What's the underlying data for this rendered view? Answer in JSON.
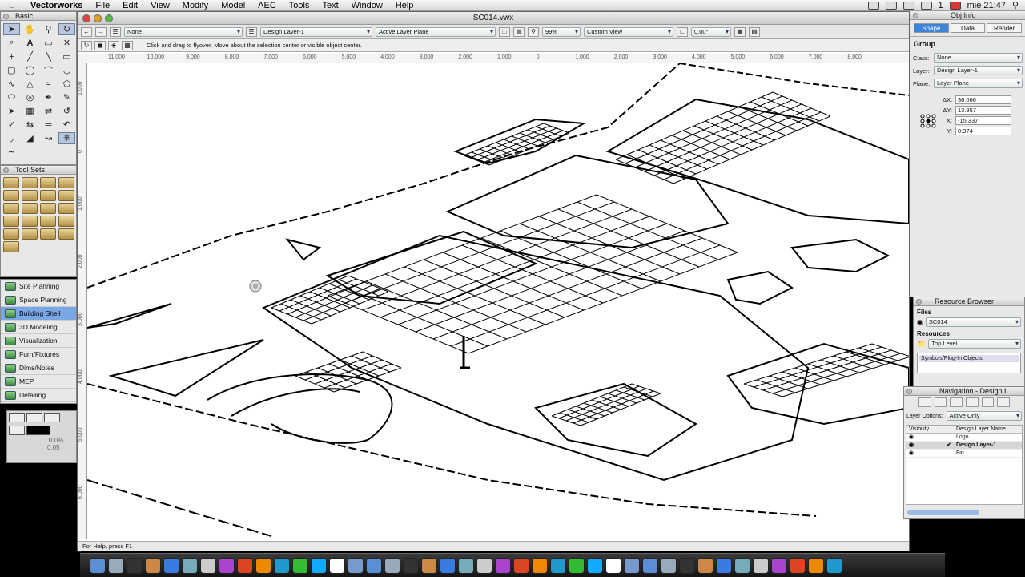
{
  "menubar": {
    "app": "Vectorworks",
    "items": [
      "File",
      "Edit",
      "View",
      "Modify",
      "Model",
      "AEC",
      "Tools",
      "Text",
      "Window",
      "Help"
    ],
    "clock": "mié 21:47",
    "count": "1"
  },
  "basic_palette": {
    "title": "Basic",
    "tools": [
      "selection-icon",
      "pan-icon",
      "zoom-icon",
      "flyover-icon",
      "text-icon",
      "line-icon",
      "rectangle-icon",
      "circle-icon",
      "arc-icon",
      "polygon-icon",
      "polyline-icon",
      "freehand-icon",
      "eyedropper-icon",
      "attribute-icon",
      "wall-icon",
      "round-wall-icon"
    ]
  },
  "toolsets": {
    "title": "Tool Sets",
    "items": [
      "Site Planning",
      "Space Planning",
      "Building Shell",
      "3D Modeling",
      "Visualization",
      "Furn/Fixtures",
      "Dims/Notes",
      "MEP",
      "Detailing"
    ],
    "active": "Building Shell"
  },
  "attributes": {
    "opacity": "100%",
    "lineweight": "0.05"
  },
  "document": {
    "title": "SC014.vwx",
    "class_select": "None",
    "layer_select": "Design Layer-1",
    "plane_select": "Active Layer Plane",
    "zoom": "99%",
    "view_select": "Custom View",
    "angle": "0.00°",
    "hint": "Click and drag to flyover. Move about the selection center or visible object center.",
    "status": "For Help, press F1",
    "ruler_h": [
      "11.000",
      "10.000",
      "9.000",
      "8.000",
      "7.000",
      "6.000",
      "5.000",
      "4.000",
      "3.000",
      "2.000",
      "1.000",
      "0",
      "1.000",
      "2.000",
      "3.000",
      "4.000",
      "5.000",
      "6.000",
      "7.000",
      "8.000"
    ],
    "ruler_v": [
      "1.000",
      "0",
      "1.000",
      "2.000",
      "3.000",
      "4.000",
      "5.000",
      "6.000",
      "7.000"
    ]
  },
  "obj_info": {
    "title": "Obj Info",
    "tabs": [
      "Shape",
      "Data",
      "Render"
    ],
    "type": "Group",
    "class_label": "Class:",
    "class_value": "None",
    "layer_label": "Layer:",
    "layer_value": "Design Layer-1",
    "plane_label": "Plane:",
    "plane_value": "Layer Plane",
    "dx_label": "ΔX:",
    "dx": "36.066",
    "dy_label": "ΔY:",
    "dy": "13.957",
    "x_label": "X:",
    "x": "-15.337",
    "y_label": "Y:",
    "y": "0.974"
  },
  "resource_browser": {
    "title": "Resource Browser",
    "files_label": "Files",
    "file": "SC014",
    "resources_label": "Resources",
    "level": "Top Level",
    "folder": "Symbols/Plug-In Objects"
  },
  "navigation": {
    "title": "Navigation - Design L...",
    "options_label": "Layer Options:",
    "options_value": "Active Only",
    "col_visibility": "Visibility",
    "col_name": "Design Layer Name",
    "layers": [
      {
        "name": "Logo",
        "active": false
      },
      {
        "name": "Design Layer-1",
        "active": true
      },
      {
        "name": "Fin",
        "active": false
      }
    ]
  },
  "dock": {
    "icons": [
      "finder-icon",
      "dashboard-icon",
      "expose-icon",
      "preview-icon",
      "safari-icon",
      "mail-icon",
      "ical-icon",
      "itunes-icon",
      "vectorworks-icon",
      "illustrator-icon",
      "photoshop-icon",
      "messages-icon",
      "skype-icon",
      "calendar-icon",
      "folder-icon",
      "app-icon",
      "app-icon",
      "app-icon",
      "app-icon",
      "app-icon",
      "app-icon",
      "app-icon",
      "app-icon",
      "app-icon",
      "app-icon",
      "app-icon",
      "app-icon",
      "app-icon",
      "app-icon",
      "app-icon",
      "app-icon",
      "app-icon",
      "app-icon",
      "app-icon",
      "app-icon",
      "app-icon",
      "app-icon",
      "app-icon",
      "app-icon",
      "app-icon",
      "trash-icon"
    ]
  }
}
